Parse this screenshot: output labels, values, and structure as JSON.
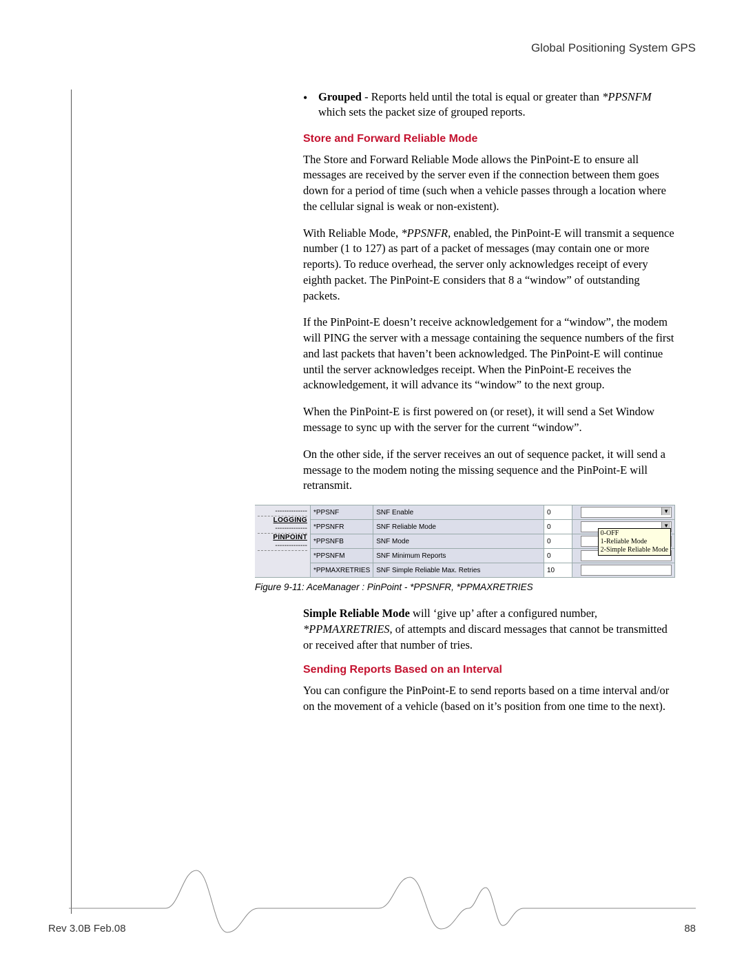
{
  "header": {
    "title": "Global Positioning System GPS"
  },
  "bullet": {
    "lead": "Grouped",
    "rest": " - Reports held until the total is equal or greater than ",
    "cmd": "*PPSNFM",
    "tail": " which sets the packet size of grouped reports."
  },
  "sections": {
    "store": {
      "heading": "Store and Forward Reliable Mode",
      "p1": "The Store and Forward Reliable Mode allows the PinPoint-E to ensure all messages are received by the server even if the connection between them goes down for a period of time (such when a vehicle passes through a location where the cellular signal is weak or non-existent).",
      "p2a": "With Reliable Mode, ",
      "p2cmd": "*PPSNFR",
      "p2b": ", enabled, the PinPoint-E will transmit a sequence number (1 to 127) as part of a packet of messages (may contain one or more reports). To reduce overhead, the server only acknowledges receipt of every eighth packet. The PinPoint-E considers that 8 a “window” of outstanding packets.",
      "p3": "If the PinPoint-E doesn’t receive acknowledgement for a “window”, the modem will PING the server with a message containing the sequence numbers of the first and last packets that haven’t been acknowledged. The PinPoint-E will continue until the server acknowledges receipt. When the PinPoint-E receives the acknowledgement, it will advance its “window” to the next group.",
      "p4": "When the PinPoint-E is first powered on (or reset), it will send a Set Window message to sync up with the server for the current “window”.",
      "p5": "On the other side, if the server receives an out of sequence packet, it will send a message to the modem noting the missing sequence and the PinPoint-E will retransmit."
    },
    "simple": {
      "lead": "Simple Reliable Mode",
      "text1": " will ‘give up’ after a configured number, ",
      "cmd": "*PPMAXRETRIES",
      "text2": ", of attempts and discard messages that cannot be transmitted or received after that number of tries."
    },
    "sending": {
      "heading": "Sending Reports Based on an Interval",
      "p1": "You can configure the PinPoint-E to send reports based on a time interval and/or on the movement of a vehicle (based on it’s position from one time to the next)."
    }
  },
  "figure": {
    "sidebar": [
      "LOGGING",
      "PINPOINT"
    ],
    "rows": [
      {
        "name": "*PPSNF",
        "desc": "SNF Enable",
        "val": "0",
        "type": "dropdown"
      },
      {
        "name": "*PPSNFR",
        "desc": "SNF Reliable Mode",
        "val": "0",
        "type": "dropdown"
      },
      {
        "name": "*PPSNFB",
        "desc": "SNF Mode",
        "val": "0",
        "type": "text"
      },
      {
        "name": "*PPSNFM",
        "desc": "SNF Minimum Reports",
        "val": "0",
        "type": "text"
      },
      {
        "name": "*PPMAXRETRIES",
        "desc": "SNF Simple Reliable Max. Retries",
        "val": "10",
        "type": "text"
      }
    ],
    "tooltip": [
      "0-OFF",
      "1-Reliable Mode",
      "2-Simple Reliable Mode"
    ],
    "caption": "Figure 9-11: AceManager : PinPoint - *PPSNFR, *PPMAXRETRIES"
  },
  "footer": {
    "rev": "Rev 3.0B  Feb.08",
    "page": "88"
  }
}
